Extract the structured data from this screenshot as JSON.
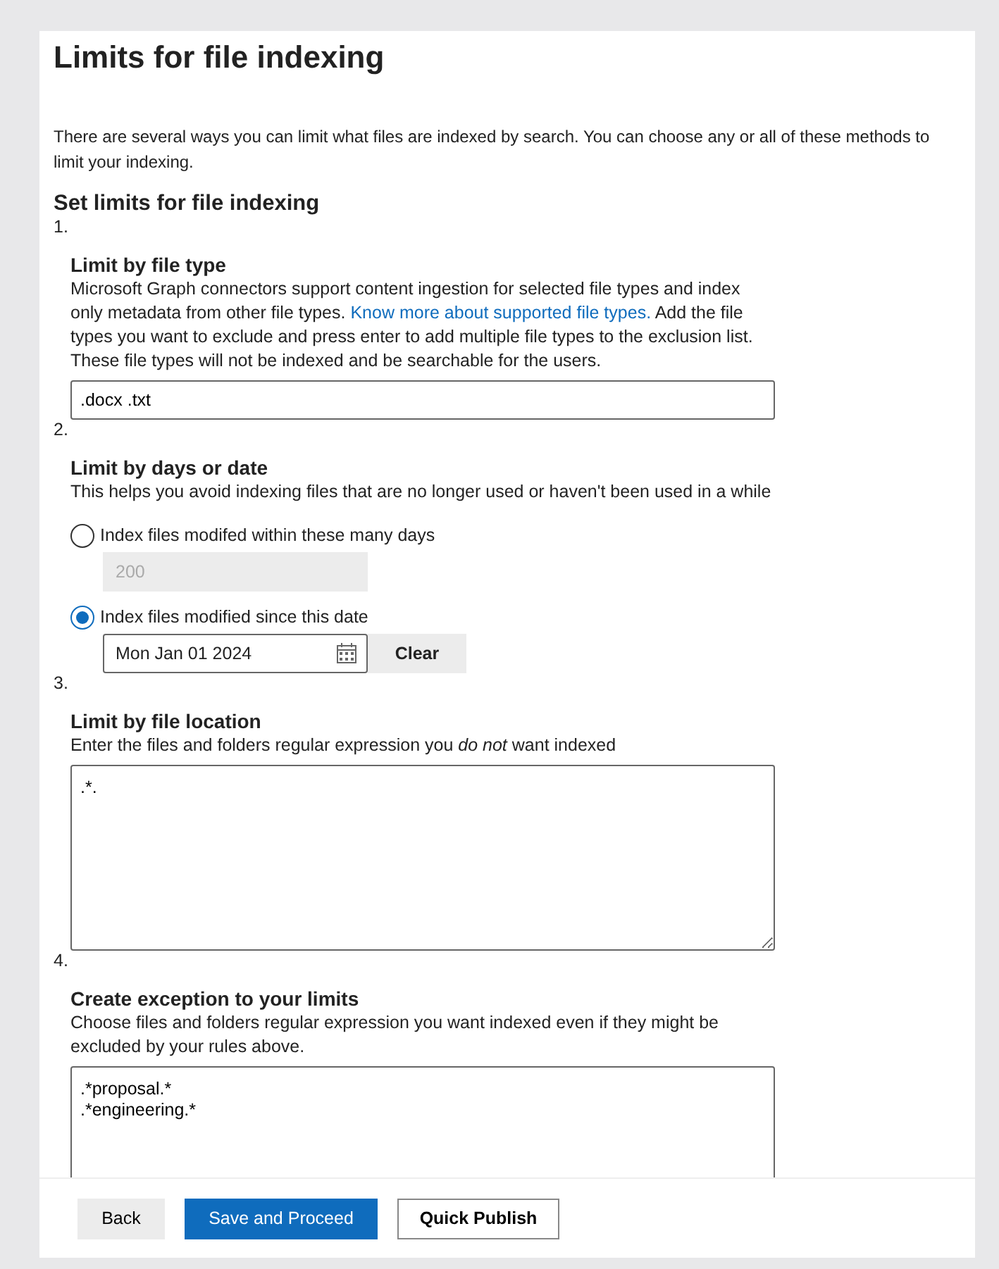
{
  "title": "Limits for file indexing",
  "intro": "There are several ways you can limit what files are indexed by search. You can choose any or all of these methods to limit your indexing.",
  "subtitle": "Set limits for file indexing",
  "sections": [
    {
      "number": "1.",
      "kind": "text-input",
      "title": "Limit by file type",
      "description": "Microsoft Graph connectors support content ingestion for selected file types and index only metadata from other file types.",
      "link": "Know more about supported file types.",
      "description_after": "Add the file types you want to exclude and press enter to add multiple file types to the exclusion list. These file types will not be indexed and be searchable for the users.",
      "value": ".docx .txt"
    },
    {
      "number": "2.",
      "kind": "radio-group",
      "title": "Limit by days or date",
      "description": "This helps you avoid indexing files that are no longer used or haven't been used in a while",
      "options": [
        {
          "label": "Index files modifed within these many days",
          "selected": false,
          "kind": "number",
          "value": "200",
          "disabled": true
        },
        {
          "label": "Index files modified since this date",
          "selected": true,
          "kind": "date",
          "value": "Mon Jan 01 2024",
          "button": "Clear",
          "disabled": false
        }
      ]
    },
    {
      "number": "3.",
      "kind": "textarea",
      "title": "Limit by file location",
      "description": "Enter the files and folders regular expression you *do not* want indexed",
      "value": ".*."
    },
    {
      "number": "4.",
      "kind": "textarea",
      "title": "Create exception to your limits",
      "description": "Choose files and folders regular expression you want indexed even if they might be excluded by your rules above.",
      "value": ".*proposal.*\n.*engineering.*"
    }
  ],
  "buttons": [
    {
      "label": "Back",
      "kind": "secondary"
    },
    {
      "label": "Save and Proceed",
      "kind": "primary"
    },
    {
      "label": "Quick Publish",
      "kind": "outline"
    }
  ]
}
